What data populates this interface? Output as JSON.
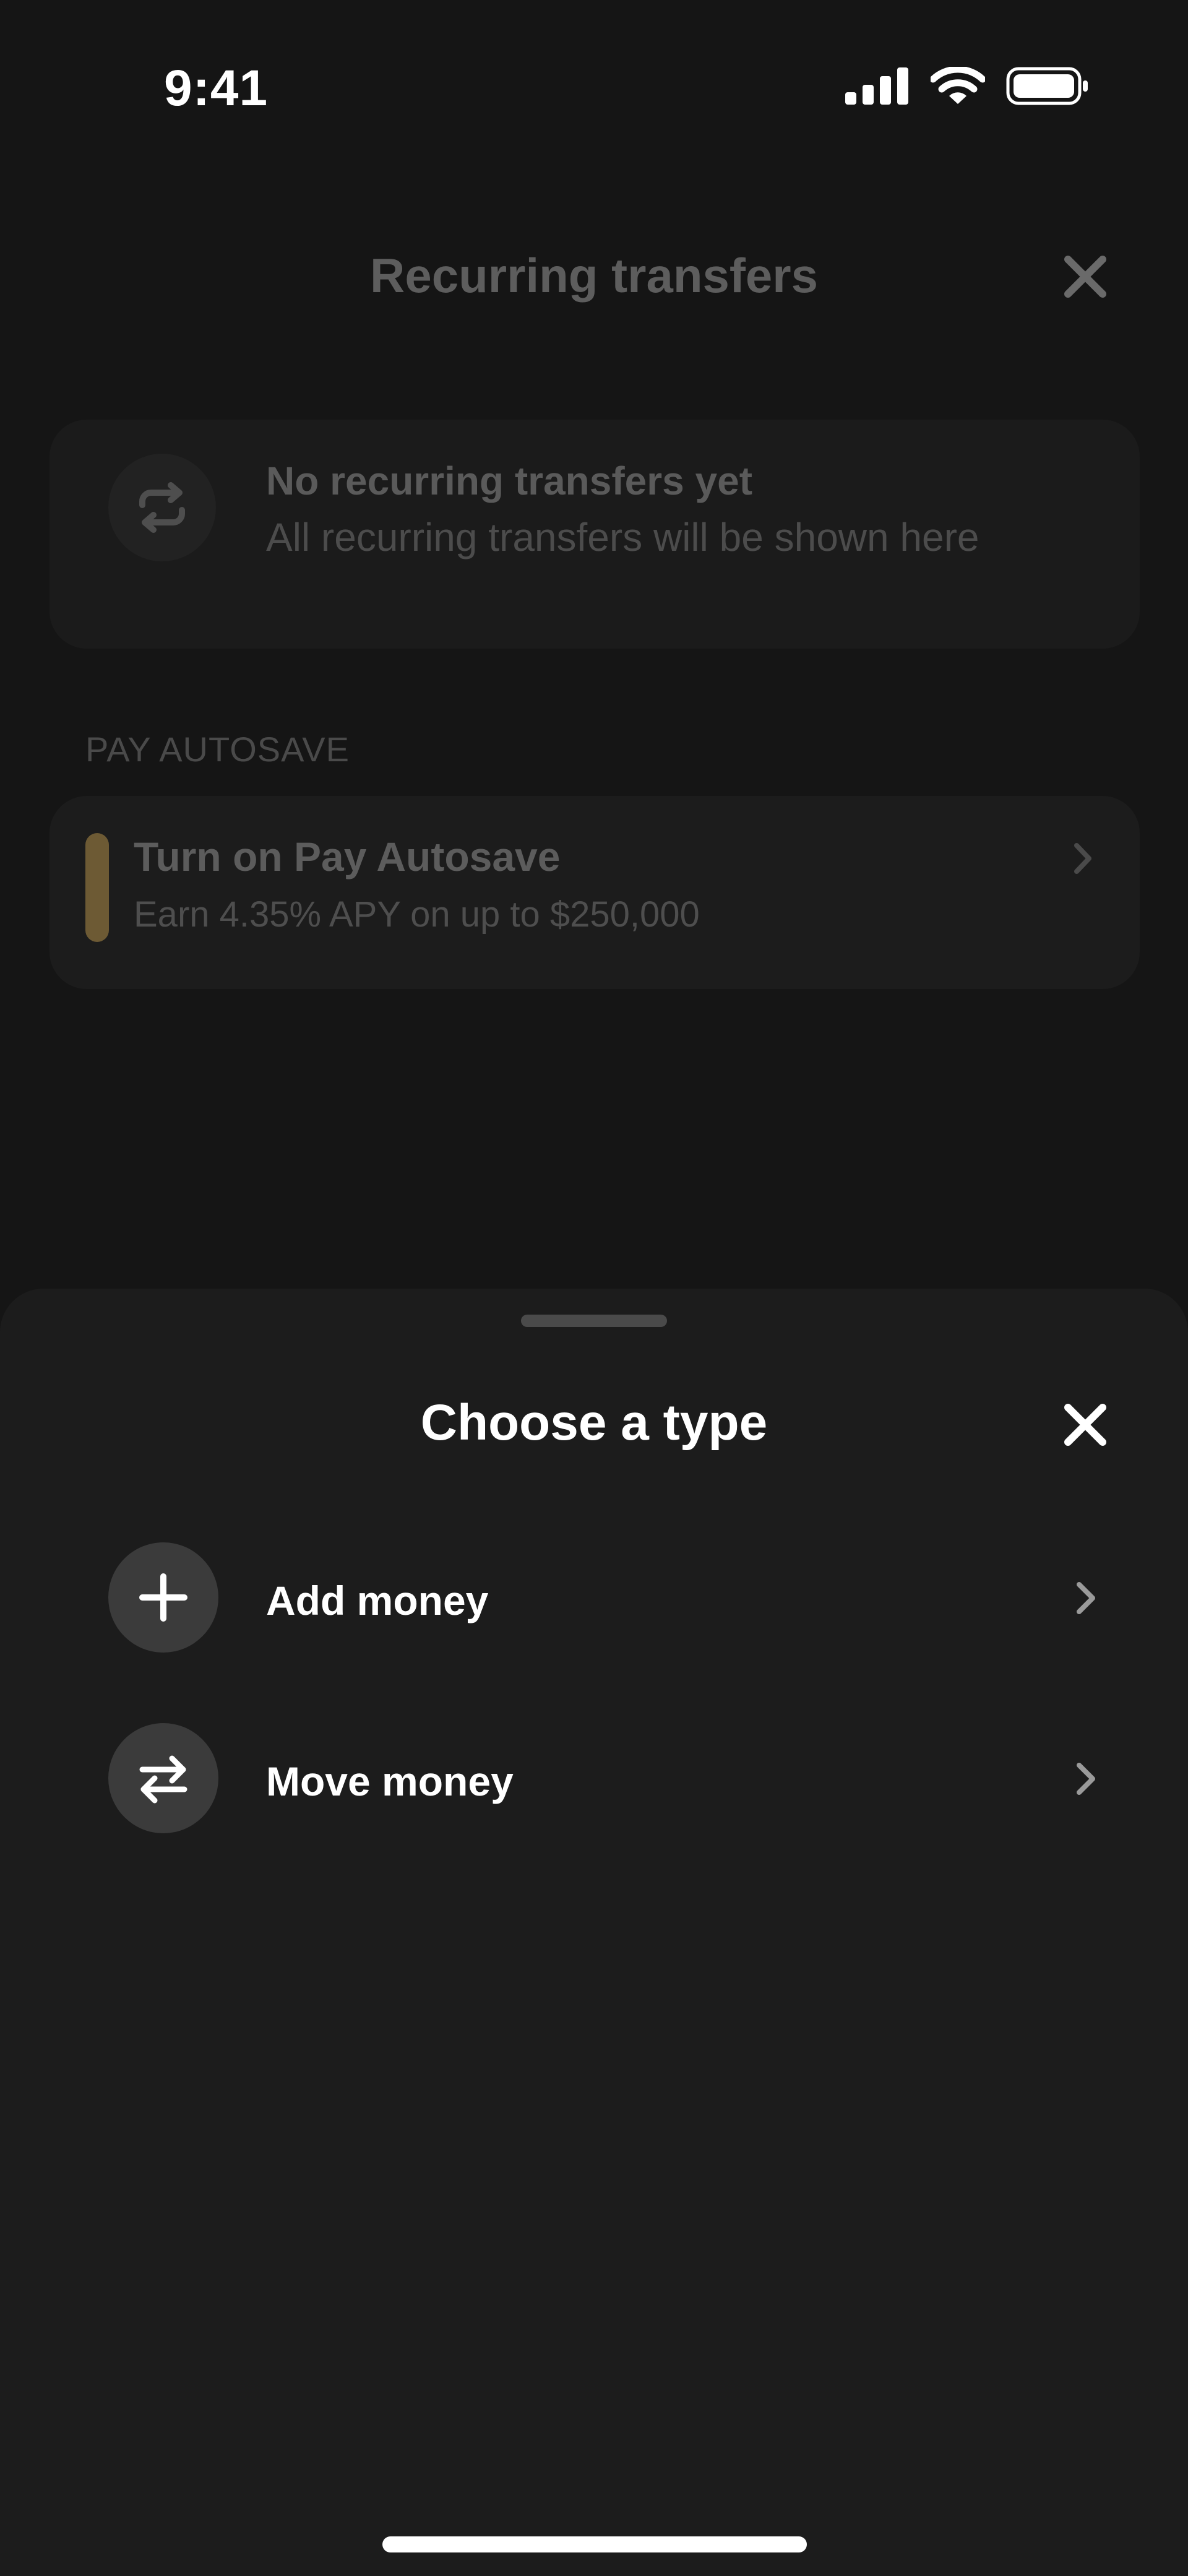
{
  "status_bar": {
    "time": "9:41",
    "icons": [
      "cellular-signal-icon",
      "wifi-icon",
      "battery-icon"
    ]
  },
  "header": {
    "title": "Recurring transfers",
    "close_icon": "close-icon"
  },
  "empty_state": {
    "icon": "repeat-icon",
    "title": "No recurring transfers yet",
    "description": "All recurring transfers will be shown here"
  },
  "pay_autosave": {
    "section_label": "PAY AUTOSAVE",
    "title": "Turn on Pay Autosave",
    "subtitle": "Earn 4.35% APY on up to $250,000",
    "accent_color": "#6d5a34"
  },
  "sheet": {
    "title": "Choose a type",
    "options": [
      {
        "label": "Add money",
        "icon": "plus-icon"
      },
      {
        "label": "Move money",
        "icon": "swap-arrows-icon"
      }
    ]
  },
  "colors": {
    "background": "#151515",
    "sheet_background": "#1c1c1c",
    "option_icon_background": "#3b3b3b",
    "text_primary": "#ffffff"
  }
}
